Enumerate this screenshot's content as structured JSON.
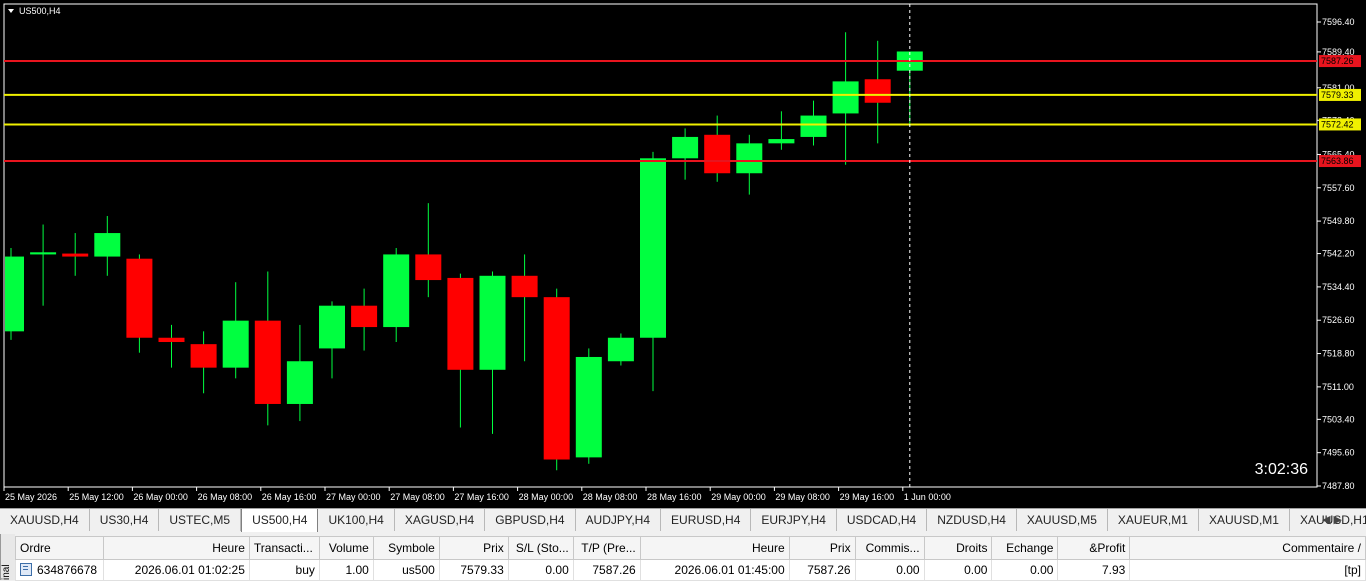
{
  "chart": {
    "symbol_label": "US500,H4",
    "countdown": "3:02:36",
    "price_levels": [
      "7596.40",
      "7589.40",
      "7581.00",
      "7573.40",
      "7565.40",
      "7557.60",
      "7549.80",
      "7542.20",
      "7534.40",
      "7526.60",
      "7518.80",
      "7511.00",
      "7503.40",
      "7495.60",
      "7487.80"
    ],
    "time_labels": [
      "25 May 2026",
      "25 May 12:00",
      "26 May 00:00",
      "26 May 08:00",
      "26 May 16:00",
      "27 May 00:00",
      "27 May 08:00",
      "27 May 16:00",
      "28 May 00:00",
      "28 May 08:00",
      "28 May 16:00",
      "29 May 00:00",
      "29 May 08:00",
      "29 May 16:00",
      "1 Jun 00:00"
    ],
    "horizontal_lines": [
      {
        "price": 7587.26,
        "label": "7587.26",
        "color": "#e8141e"
      },
      {
        "price": 7579.33,
        "label": "7579.33",
        "color": "#f0f000"
      },
      {
        "price": 7572.42,
        "label": "7572.42",
        "color": "#f0f000"
      },
      {
        "price": 7563.86,
        "label": "7563.86",
        "color": "#e8141e"
      }
    ],
    "colors": {
      "bull": "#00ff40",
      "bear": "#ff0000",
      "wick": "#00ff40",
      "grid": "#ffffff"
    }
  },
  "chart_data": {
    "type": "candlestick",
    "title": "US500,H4",
    "ylim": [
      7487.8,
      7596.4
    ],
    "candles": [
      {
        "t": "25 May 2026",
        "o": 7524.0,
        "h": 7543.5,
        "l": 7522.0,
        "c": 7541.5
      },
      {
        "t": "",
        "o": 7542.0,
        "h": 7549.0,
        "l": 7530.0,
        "c": 7542.5
      },
      {
        "t": "25 May 12:00",
        "o": 7542.2,
        "h": 7547.0,
        "l": 7537.0,
        "c": 7541.5
      },
      {
        "t": "",
        "o": 7541.5,
        "h": 7551.0,
        "l": 7537.0,
        "c": 7547.0
      },
      {
        "t": "26 May 00:00",
        "o": 7541.0,
        "h": 7542.0,
        "l": 7519.0,
        "c": 7522.5
      },
      {
        "t": "",
        "o": 7522.5,
        "h": 7525.5,
        "l": 7515.5,
        "c": 7521.5
      },
      {
        "t": "26 May 08:00",
        "o": 7521.0,
        "h": 7524.0,
        "l": 7509.5,
        "c": 7515.5
      },
      {
        "t": "",
        "o": 7515.5,
        "h": 7535.5,
        "l": 7513.0,
        "c": 7526.5
      },
      {
        "t": "26 May 16:00",
        "o": 7526.5,
        "h": 7538.0,
        "l": 7502.0,
        "c": 7507.0
      },
      {
        "t": "",
        "o": 7507.0,
        "h": 7525.5,
        "l": 7503.0,
        "c": 7517.0
      },
      {
        "t": "27 May 00:00",
        "o": 7520.0,
        "h": 7531.0,
        "l": 7513.0,
        "c": 7530.0
      },
      {
        "t": "",
        "o": 7530.0,
        "h": 7534.0,
        "l": 7519.5,
        "c": 7525.0
      },
      {
        "t": "27 May 08:00",
        "o": 7525.0,
        "h": 7543.5,
        "l": 7521.5,
        "c": 7542.0
      },
      {
        "t": "",
        "o": 7542.0,
        "h": 7554.0,
        "l": 7532.0,
        "c": 7536.0
      },
      {
        "t": "27 May 16:00",
        "o": 7536.5,
        "h": 7537.5,
        "l": 7501.5,
        "c": 7515.0
      },
      {
        "t": "",
        "o": 7515.0,
        "h": 7538.0,
        "l": 7500.0,
        "c": 7537.0
      },
      {
        "t": "28 May 00:00",
        "o": 7537.0,
        "h": 7542.0,
        "l": 7517.0,
        "c": 7532.0
      },
      {
        "t": "",
        "o": 7532.0,
        "h": 7534.0,
        "l": 7491.5,
        "c": 7494.0
      },
      {
        "t": "28 May 08:00",
        "o": 7494.5,
        "h": 7520.0,
        "l": 7493.0,
        "c": 7518.0
      },
      {
        "t": "",
        "o": 7517.0,
        "h": 7523.5,
        "l": 7516.0,
        "c": 7522.5
      },
      {
        "t": "28 May 16:00",
        "o": 7522.5,
        "h": 7566.0,
        "l": 7510.0,
        "c": 7564.5
      },
      {
        "t": "",
        "o": 7564.5,
        "h": 7571.5,
        "l": 7559.5,
        "c": 7569.5
      },
      {
        "t": "29 May 00:00",
        "o": 7570.0,
        "h": 7574.5,
        "l": 7559.0,
        "c": 7561.0
      },
      {
        "t": "",
        "o": 7561.0,
        "h": 7570.0,
        "l": 7556.0,
        "c": 7568.0
      },
      {
        "t": "29 May 08:00",
        "o": 7568.0,
        "h": 7575.5,
        "l": 7566.5,
        "c": 7569.0
      },
      {
        "t": "",
        "o": 7569.5,
        "h": 7578.0,
        "l": 7567.5,
        "c": 7574.5
      },
      {
        "t": "29 May 16:00",
        "o": 7575.0,
        "h": 7594.0,
        "l": 7563.0,
        "c": 7582.5
      },
      {
        "t": "",
        "o": 7583.0,
        "h": 7592.0,
        "l": 7568.0,
        "c": 7577.5
      },
      {
        "t": "1 Jun 00:00",
        "o": 7585.0,
        "h": 7585.5,
        "l": 7572.0,
        "c": 7589.5
      }
    ]
  },
  "tabs": [
    "XAUUSD,H4",
    "US30,H4",
    "USTEC,M5",
    "US500,H4",
    "UK100,H4",
    "XAGUSD,H4",
    "GBPUSD,H4",
    "AUDJPY,H4",
    "EURUSD,H4",
    "EURJPY,H4",
    "USDCAD,H4",
    "NZDUSD,H4",
    "XAUUSD,M5",
    "XAUEUR,M1",
    "XAUUSD,M1",
    "XAUUSD,H1"
  ],
  "active_tab": 3,
  "terminal_label": "inal",
  "trade_table": {
    "headers": [
      "Ordre",
      "Heure",
      "Transacti...",
      "Volume",
      "Symbole",
      "Prix",
      "S/L (Sto...",
      "T/P (Pre...",
      "Heure",
      "Prix",
      "Commis...",
      "Droits",
      "Echange",
      "&Profit",
      "Commentaire"
    ],
    "row": [
      "634876678",
      "2026.06.01 01:02:25",
      "buy",
      "1.00",
      "us500",
      "7579.33",
      "0.00",
      "7587.26",
      "2026.06.01 01:45:00",
      "7587.26",
      "0.00",
      "0.00",
      "0.00",
      "7.93",
      "[tp]"
    ]
  }
}
